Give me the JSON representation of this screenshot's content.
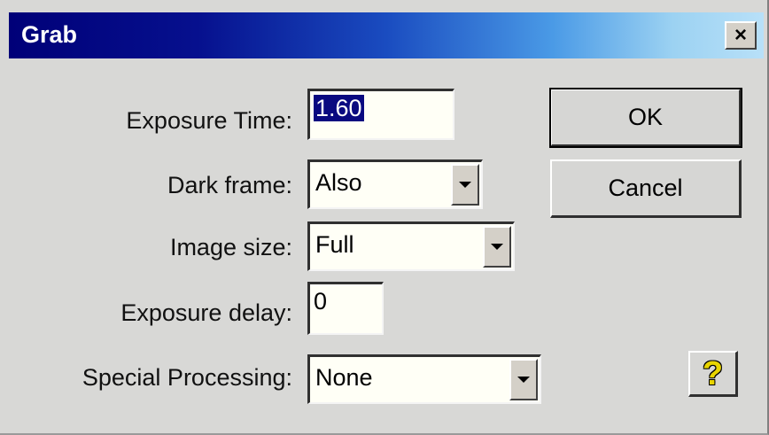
{
  "window": {
    "title": "Grab",
    "close_glyph": "×"
  },
  "form": {
    "exposure_time": {
      "label": "Exposure Time:",
      "value": "1.60",
      "selected": true
    },
    "dark_frame": {
      "label": "Dark frame:",
      "value": "Also"
    },
    "image_size": {
      "label": "Image size:",
      "value": "Full"
    },
    "exposure_delay": {
      "label": "Exposure delay:",
      "value": "0"
    },
    "special_processing": {
      "label": "Special Processing:",
      "value": "None"
    }
  },
  "buttons": {
    "ok": "OK",
    "cancel": "Cancel",
    "help_glyph": "?"
  },
  "icons": {
    "close": "close-icon",
    "dropdown": "chevron-down-icon",
    "help": "help-icon"
  },
  "colors": {
    "titlebar_start": "#000078",
    "titlebar_end": "#b8e0f8",
    "dialog_bg": "#d8d8d6",
    "selection": "#0a0a80",
    "help_icon": "#e8d400"
  }
}
